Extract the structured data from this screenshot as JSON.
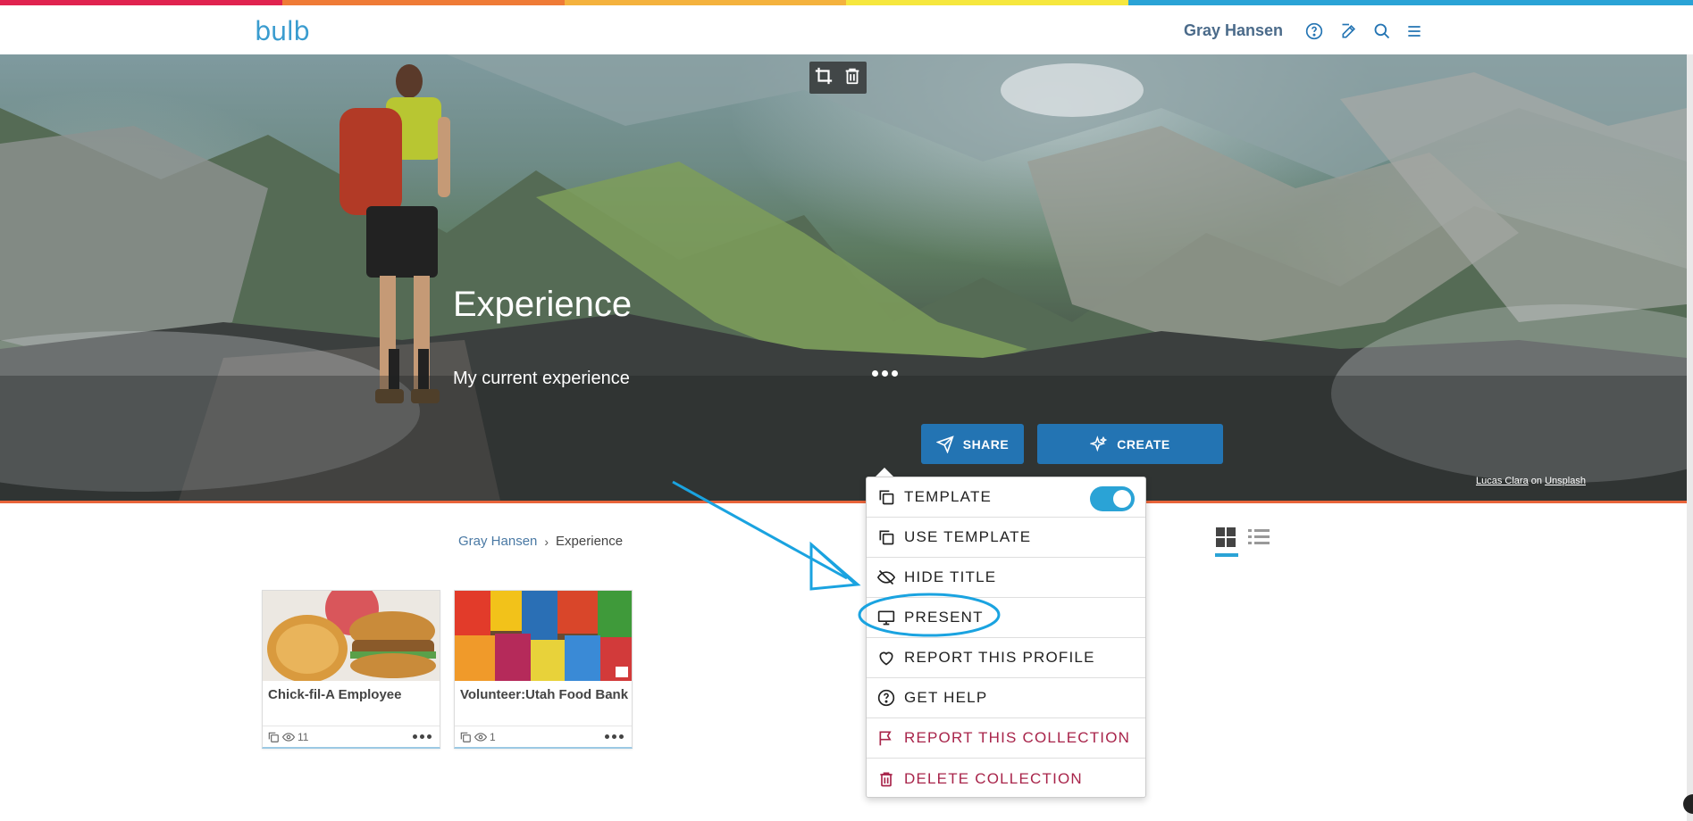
{
  "colors": {
    "rainbow": [
      "#e0234f",
      "#ef7b36",
      "#f4b23e",
      "#f6e73e",
      "#2aa3d6",
      "#2aa3d6"
    ],
    "accent": "#2374b3",
    "toggle": "#2aa3d6",
    "danger": "#a8244a",
    "annotation": "#1aa3e0"
  },
  "header": {
    "logo": "bulb",
    "user_name": "Gray Hansen",
    "icons": [
      "help-icon",
      "edit-icon",
      "search-icon",
      "menu-icon"
    ]
  },
  "hero": {
    "title": "Experience",
    "subtitle": "My current experience",
    "share_label": "SHARE",
    "create_label": "CREATE",
    "credit": {
      "author": "Lucas Clara",
      "on": "on",
      "source": "Unsplash"
    }
  },
  "breadcrumb": {
    "parent": "Gray Hansen",
    "current": "Experience"
  },
  "cards": [
    {
      "title": "Chick-fil-A Employee",
      "views": "11"
    },
    {
      "title": "Volunteer:Utah Food Bank",
      "views": "1"
    }
  ],
  "menu": {
    "items": [
      {
        "label": "TEMPLATE",
        "icon": "copy-icon",
        "toggle_on": true
      },
      {
        "label": "USE TEMPLATE",
        "icon": "copy-icon"
      },
      {
        "label": "HIDE TITLE",
        "icon": "eye-off-icon"
      },
      {
        "label": "PRESENT",
        "icon": "monitor-icon"
      },
      {
        "label": "REPORT THIS PROFILE",
        "icon": "heart-icon"
      },
      {
        "label": "GET HELP",
        "icon": "help-icon"
      },
      {
        "label": "REPORT THIS COLLECTION",
        "icon": "flag-icon"
      },
      {
        "label": "DELETE COLLECTION",
        "icon": "trash-icon"
      }
    ]
  }
}
